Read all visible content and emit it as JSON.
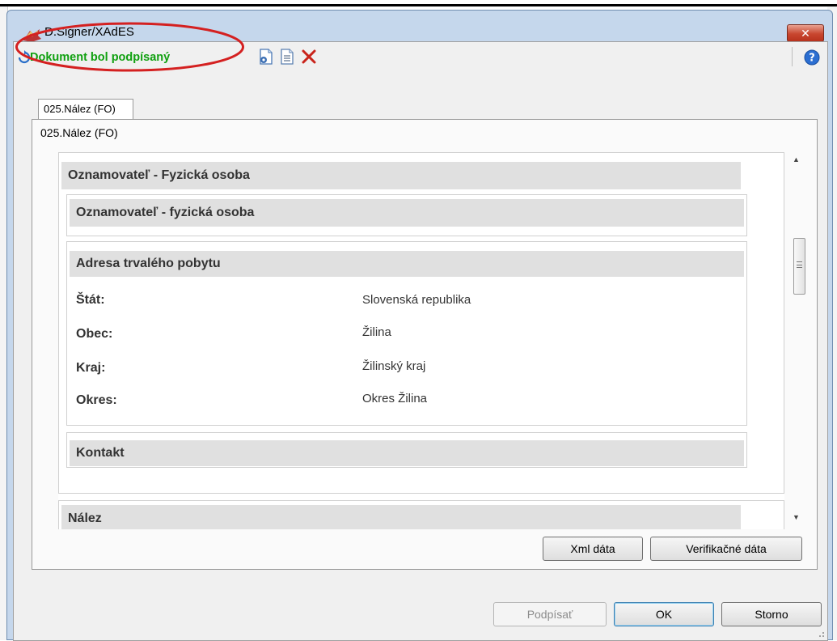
{
  "window": {
    "title": "D.Signer/XAdES",
    "close_label": "✕"
  },
  "toolbar": {
    "status_text": "Dokument bol podpísaný",
    "status_color": "#10a010",
    "tools": [
      "settings-document-icon",
      "document-icon",
      "delete-icon"
    ],
    "help_icon": "help-icon"
  },
  "tab": {
    "label": "025.Nález (FO)"
  },
  "document": {
    "heading": "025.Nález (FO)",
    "section_main": "Oznamovateľ - Fyzická osoba",
    "section_person": "Oznamovateľ - fyzická osoba",
    "address": {
      "header": "Adresa trvalého pobytu",
      "rows": [
        {
          "label": "Štát:",
          "value": "Slovenská republika"
        },
        {
          "label": "Obec:",
          "value": "Žilina"
        },
        {
          "label": "Kraj:",
          "value": "Žilinský kraj"
        },
        {
          "label": "Okres:",
          "value": "Okres Žilina"
        }
      ]
    },
    "section_contact": "Kontakt",
    "section_finding": "Nález"
  },
  "buttons": {
    "xml": "Xml dáta",
    "verify": "Verifikačné dáta",
    "sign": "Podpísať",
    "ok": "OK",
    "cancel": "Storno"
  },
  "colors": {
    "highlight": "#d42020",
    "status_green": "#10a010"
  }
}
